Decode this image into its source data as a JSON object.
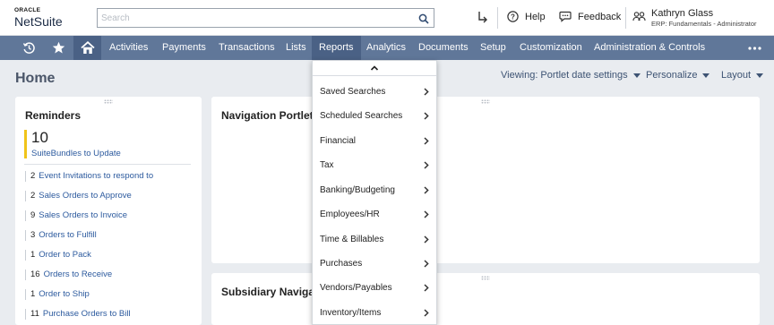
{
  "app": {
    "logo_brand": "ORACLE",
    "logo_product": "NetSuite"
  },
  "search": {
    "placeholder": "Search",
    "value": ""
  },
  "header": {
    "help_label": "Help",
    "feedback_label": "Feedback",
    "user_name": "Kathryn Glass",
    "user_role": "ERP: Fundamentals - Administrator"
  },
  "nav": {
    "items": [
      "Activities",
      "Payments",
      "Transactions",
      "Lists",
      "Reports",
      "Analytics",
      "Documents",
      "Setup",
      "Customization",
      "Administration & Controls"
    ],
    "active": "Reports"
  },
  "page": {
    "title": "Home",
    "viewing_label": "Viewing: Portlet date settings",
    "personalize_label": "Personalize",
    "layout_label": "Layout"
  },
  "reminders": {
    "title": "Reminders",
    "highlight": {
      "count": "10",
      "label": "SuiteBundles to Update"
    },
    "items": [
      {
        "count": "2",
        "label": "Event Invitations to respond to"
      },
      {
        "count": "2",
        "label": "Sales Orders to Approve"
      },
      {
        "count": "9",
        "label": "Sales Orders to Invoice"
      },
      {
        "count": "3",
        "label": "Orders to Fulfill"
      },
      {
        "count": "1",
        "label": "Order to Pack"
      },
      {
        "count": "16",
        "label": "Orders to Receive"
      },
      {
        "count": "1",
        "label": "Order to Ship"
      },
      {
        "count": "11",
        "label": "Purchase Orders to Bill"
      }
    ]
  },
  "portlets": {
    "navigation_title": "Navigation Portlet",
    "subsidiary_title": "Subsidiary Navigato"
  },
  "reports_menu": {
    "items": [
      "Saved Searches",
      "Scheduled Searches",
      "Financial",
      "Tax",
      "Banking/Budgeting",
      "Employees/HR",
      "Time & Billables",
      "Purchases",
      "Vendors/Payables",
      "Inventory/Items"
    ]
  },
  "colors": {
    "nav_bg": "#607799",
    "nav_active": "#4a6185",
    "link": "#2c5a9e",
    "highlight": "#f0c419"
  }
}
